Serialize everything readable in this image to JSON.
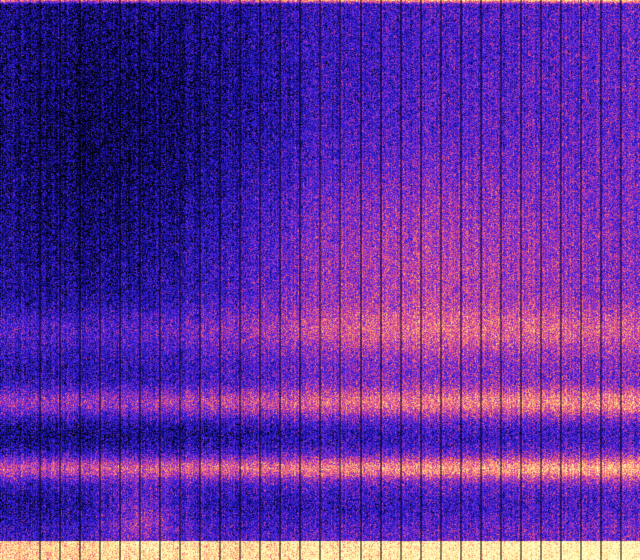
{
  "image": {
    "kind": "spectrogram-heatmap",
    "colormap": {
      "name": "gnuplot-style",
      "stops": [
        "#000000",
        "#120f7a",
        "#2a1ad8",
        "#6a2ad0",
        "#c23aa8",
        "#f26a7a",
        "#ffb078",
        "#fff2a0",
        "#ffffc8"
      ]
    },
    "background_color": "#0c0a52",
    "gridline_color": "#000000",
    "vertical_gridline_count": 32
  }
}
